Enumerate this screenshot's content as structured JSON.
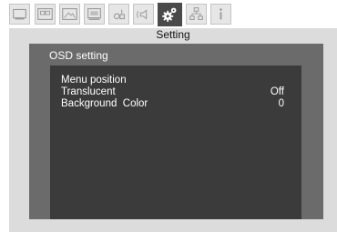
{
  "tabs": [
    {
      "icon": "monitor-icon"
    },
    {
      "icon": "picture-in-picture-icon"
    },
    {
      "icon": "image-icon"
    },
    {
      "icon": "screen-icon"
    },
    {
      "icon": "setup-icon"
    },
    {
      "icon": "audio-icon"
    },
    {
      "icon": "gear-icon",
      "active": true
    },
    {
      "icon": "network-icon"
    },
    {
      "icon": "info-icon"
    }
  ],
  "window": {
    "title": "Setting",
    "panel": {
      "title": "OSD setting",
      "rows": [
        {
          "label": "Menu position",
          "value": ""
        },
        {
          "label": "Translucent",
          "value": "Off"
        },
        {
          "label": "Background  Color",
          "value": "0"
        }
      ]
    }
  },
  "colors": {
    "window_bg": "#dcdcdc",
    "panel_bg": "#6b6b6b",
    "list_bg": "#3b3b3b",
    "active_tab": "#4a4a4a"
  }
}
